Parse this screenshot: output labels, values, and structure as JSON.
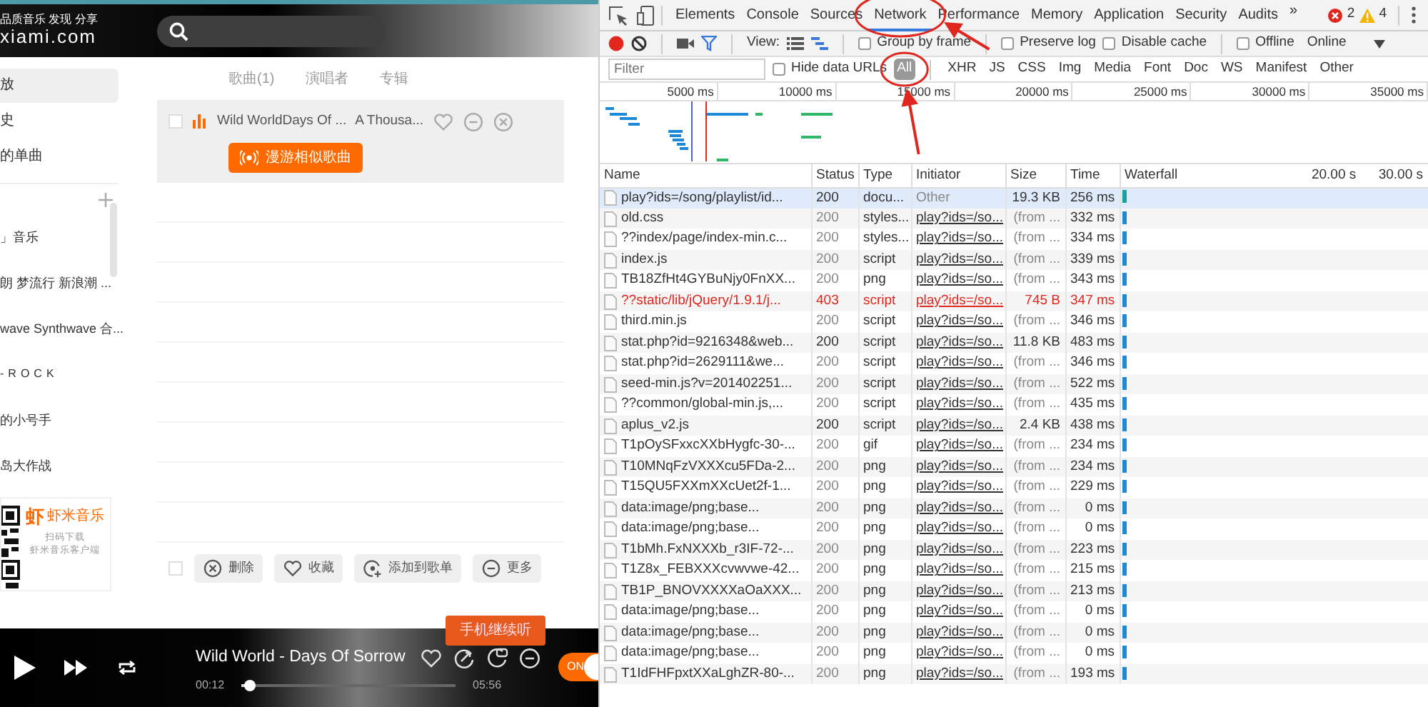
{
  "app": {
    "logo": {
      "tagline": "品质音乐 发现 分享",
      "domain": "xiami.com"
    },
    "nav": [
      {
        "label": "放",
        "selected": true
      },
      {
        "label": "史",
        "selected": false
      },
      {
        "label": "的单曲",
        "selected": false
      }
    ],
    "playlists": [
      "」音乐",
      "朗 梦流行 新浪潮 ...",
      "wave Synthwave 合...",
      "-ROCK",
      "的小号手",
      "岛大作战"
    ],
    "qr_card": {
      "logo_mark": "虾",
      "brand": "虾米音乐",
      "line1": "扫码下载",
      "line2": "虾米音乐客户端"
    },
    "result_tabs": [
      "歌曲(1)",
      "演唱者",
      "专辑"
    ],
    "songs": [
      {
        "title": "Wild WorldDays Of ...",
        "album": "A Thousa...",
        "checked": false,
        "playing": true,
        "action": "漫游相似歌曲"
      }
    ],
    "select_all_checked": false,
    "bulk_actions": [
      "删除",
      "收藏",
      "添加到歌单",
      "更多"
    ],
    "tooltip": "手机继续听",
    "player": {
      "title": "Wild World - Days Of Sorrow",
      "elapsed": "00:12",
      "duration": "05:56",
      "level": 0.04,
      "toggle": {
        "label": "ON",
        "on": true
      }
    }
  },
  "devtools": {
    "tabs": [
      {
        "label": "Elements",
        "selected": false
      },
      {
        "label": "Console",
        "selected": false
      },
      {
        "label": "Sources",
        "selected": false
      },
      {
        "label": "Network",
        "selected": true,
        "circled": true
      },
      {
        "label": "Performance",
        "selected": false
      },
      {
        "label": "Memory",
        "selected": false
      },
      {
        "label": "Application",
        "selected": false
      },
      {
        "label": "Security",
        "selected": false
      },
      {
        "label": "Audits",
        "selected": false
      }
    ],
    "overflow": "»",
    "errors": "2",
    "warnings": "4",
    "toolbar": {
      "recording": true,
      "filter_on": true,
      "view_label": "View:",
      "checkboxes": [
        {
          "label": "Group by frame",
          "checked": false
        },
        {
          "label": "Preserve log",
          "checked": false
        },
        {
          "label": "Disable cache",
          "checked": false
        },
        {
          "label": "Offline",
          "checked": false
        }
      ],
      "throttle": "Online"
    },
    "filter_bar": {
      "placeholder": "Filter",
      "hide_data_urls": {
        "label": "Hide data URLs",
        "checked": false
      },
      "types": [
        {
          "label": "All",
          "selected": true,
          "circled": true
        },
        {
          "label": "XHR",
          "selected": false
        },
        {
          "label": "JS",
          "selected": false
        },
        {
          "label": "CSS",
          "selected": false
        },
        {
          "label": "Img",
          "selected": false
        },
        {
          "label": "Media",
          "selected": false
        },
        {
          "label": "Font",
          "selected": false
        },
        {
          "label": "Doc",
          "selected": false
        },
        {
          "label": "WS",
          "selected": false
        },
        {
          "label": "Manifest",
          "selected": false
        },
        {
          "label": "Other",
          "selected": false
        }
      ]
    },
    "overview_ticks": [
      "5000 ms",
      "10000 ms",
      "15000 ms",
      "20000 ms",
      "25000 ms",
      "30000 ms",
      "35000 ms"
    ],
    "columns": [
      "Name",
      "Status",
      "Type",
      "Initiator",
      "Size",
      "Time",
      "Waterfall"
    ],
    "waterfall_ticks": [
      "20.00 s",
      "30.00 s"
    ],
    "requests": [
      {
        "name": "play?ids=/song/playlist/id...",
        "status": "200",
        "type": "docu...",
        "initiator": "Other",
        "size": "19.3 KB",
        "time": "256 ms",
        "selected": true,
        "failed": false,
        "cached": false,
        "initiator_link": false
      },
      {
        "name": "old.css",
        "status": "200",
        "type": "styles...",
        "initiator": "play?ids=/so...",
        "size": "(from ...",
        "time": "332 ms",
        "selected": false,
        "failed": false,
        "cached": true,
        "initiator_link": true
      },
      {
        "name": "??index/page/index-min.c...",
        "status": "200",
        "type": "styles...",
        "initiator": "play?ids=/so...",
        "size": "(from ...",
        "time": "334 ms",
        "selected": false,
        "failed": false,
        "cached": true,
        "initiator_link": true
      },
      {
        "name": "index.js",
        "status": "200",
        "type": "script",
        "initiator": "play?ids=/so...",
        "size": "(from ...",
        "time": "339 ms",
        "selected": false,
        "failed": false,
        "cached": true,
        "initiator_link": true
      },
      {
        "name": "TB18ZfHt4GYBuNjy0FnXX...",
        "status": "200",
        "type": "png",
        "initiator": "play?ids=/so...",
        "size": "(from ...",
        "time": "343 ms",
        "selected": false,
        "failed": false,
        "cached": true,
        "initiator_link": true
      },
      {
        "name": "??static/lib/jQuery/1.9.1/j...",
        "status": "403",
        "type": "script",
        "initiator": "play?ids=/so...",
        "size": "745 B",
        "time": "347 ms",
        "selected": false,
        "failed": true,
        "cached": false,
        "initiator_link": true
      },
      {
        "name": "third.min.js",
        "status": "200",
        "type": "script",
        "initiator": "play?ids=/so...",
        "size": "(from ...",
        "time": "346 ms",
        "selected": false,
        "failed": false,
        "cached": true,
        "initiator_link": true
      },
      {
        "name": "stat.php?id=9216348&web...",
        "status": "200",
        "type": "script",
        "initiator": "play?ids=/so...",
        "size": "11.8 KB",
        "time": "483 ms",
        "selected": false,
        "failed": false,
        "cached": false,
        "initiator_link": true
      },
      {
        "name": "stat.php?id=2629111&we...",
        "status": "200",
        "type": "script",
        "initiator": "play?ids=/so...",
        "size": "(from ...",
        "time": "346 ms",
        "selected": false,
        "failed": false,
        "cached": true,
        "initiator_link": true
      },
      {
        "name": "seed-min.js?v=201402251...",
        "status": "200",
        "type": "script",
        "initiator": "play?ids=/so...",
        "size": "(from ...",
        "time": "522 ms",
        "selected": false,
        "failed": false,
        "cached": true,
        "initiator_link": true
      },
      {
        "name": "??common/global-min.js,...",
        "status": "200",
        "type": "script",
        "initiator": "play?ids=/so...",
        "size": "(from ...",
        "time": "435 ms",
        "selected": false,
        "failed": false,
        "cached": true,
        "initiator_link": true
      },
      {
        "name": "aplus_v2.js",
        "status": "200",
        "type": "script",
        "initiator": "play?ids=/so...",
        "size": "2.4 KB",
        "time": "438 ms",
        "selected": false,
        "failed": false,
        "cached": false,
        "initiator_link": true
      },
      {
        "name": "T1pOySFxxcXXbHygfc-30-...",
        "status": "200",
        "type": "gif",
        "initiator": "play?ids=/so...",
        "size": "(from ...",
        "time": "234 ms",
        "selected": false,
        "failed": false,
        "cached": true,
        "initiator_link": true
      },
      {
        "name": "T10MNqFzVXXXcu5FDa-2...",
        "status": "200",
        "type": "png",
        "initiator": "play?ids=/so...",
        "size": "(from ...",
        "time": "234 ms",
        "selected": false,
        "failed": false,
        "cached": true,
        "initiator_link": true
      },
      {
        "name": "T15QU5FXXmXXcUet2f-1...",
        "status": "200",
        "type": "png",
        "initiator": "play?ids=/so...",
        "size": "(from ...",
        "time": "229 ms",
        "selected": false,
        "failed": false,
        "cached": true,
        "initiator_link": true
      },
      {
        "name": "data:image/png;base...",
        "status": "200",
        "type": "png",
        "initiator": "play?ids=/so...",
        "size": "(from ...",
        "time": "0 ms",
        "selected": false,
        "failed": false,
        "cached": true,
        "initiator_link": true
      },
      {
        "name": "data:image/png;base...",
        "status": "200",
        "type": "png",
        "initiator": "play?ids=/so...",
        "size": "(from ...",
        "time": "0 ms",
        "selected": false,
        "failed": false,
        "cached": true,
        "initiator_link": true
      },
      {
        "name": "T1bMh.FxNXXXb_r3IF-72-...",
        "status": "200",
        "type": "png",
        "initiator": "play?ids=/so...",
        "size": "(from ...",
        "time": "223 ms",
        "selected": false,
        "failed": false,
        "cached": true,
        "initiator_link": true
      },
      {
        "name": "T1Z8x_FEBXXXcvwvwe-42...",
        "status": "200",
        "type": "png",
        "initiator": "play?ids=/so...",
        "size": "(from ...",
        "time": "215 ms",
        "selected": false,
        "failed": false,
        "cached": true,
        "initiator_link": true
      },
      {
        "name": "TB1P_BNOVXXXXaOaXXX...",
        "status": "200",
        "type": "png",
        "initiator": "play?ids=/so...",
        "size": "(from ...",
        "time": "213 ms",
        "selected": false,
        "failed": false,
        "cached": true,
        "initiator_link": true
      },
      {
        "name": "data:image/png;base...",
        "status": "200",
        "type": "png",
        "initiator": "play?ids=/so...",
        "size": "(from ...",
        "time": "0 ms",
        "selected": false,
        "failed": false,
        "cached": true,
        "initiator_link": true
      },
      {
        "name": "data:image/png;base...",
        "status": "200",
        "type": "png",
        "initiator": "play?ids=/so...",
        "size": "(from ...",
        "time": "0 ms",
        "selected": false,
        "failed": false,
        "cached": true,
        "initiator_link": true
      },
      {
        "name": "data:image/png;base...",
        "status": "200",
        "type": "png",
        "initiator": "play?ids=/so...",
        "size": "(from ...",
        "time": "0 ms",
        "selected": false,
        "failed": false,
        "cached": true,
        "initiator_link": true
      },
      {
        "name": "T1IdFHFpxtXXaLghZR-80-...",
        "status": "200",
        "type": "png",
        "initiator": "play?ids=/so...",
        "size": "(from ...",
        "time": "193 ms",
        "selected": false,
        "failed": false,
        "cached": true,
        "initiator_link": true
      }
    ]
  }
}
